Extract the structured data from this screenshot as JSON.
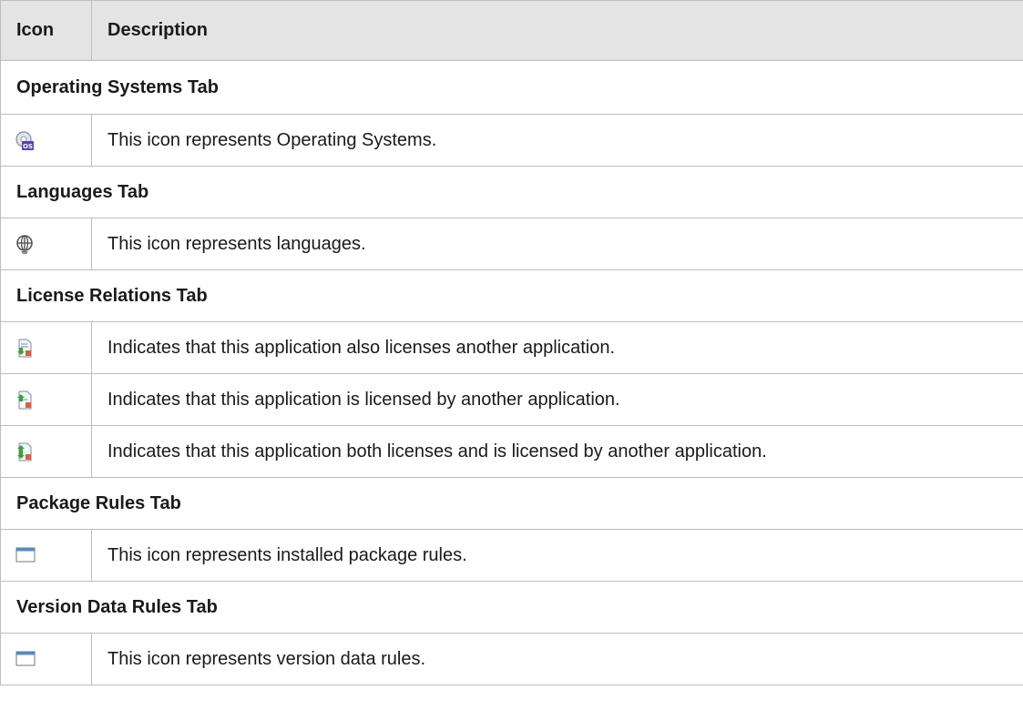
{
  "table": {
    "headers": {
      "icon": "Icon",
      "description": "Description"
    },
    "sections": [
      {
        "title": "Operating Systems Tab",
        "rows": [
          {
            "icon": "operating-system-icon",
            "text": "This icon represents Operating Systems."
          }
        ]
      },
      {
        "title": "Languages Tab",
        "rows": [
          {
            "icon": "globe-icon",
            "text": "This icon represents languages."
          }
        ]
      },
      {
        "title": "License Relations Tab",
        "rows": [
          {
            "icon": "licenses-another-icon",
            "text": "Indicates that this application also licenses another application."
          },
          {
            "icon": "licensed-by-another-icon",
            "text": "Indicates that this application is licensed by another application."
          },
          {
            "icon": "licenses-and-licensed-icon",
            "text": "Indicates that this application both licenses and is licensed by another application."
          }
        ]
      },
      {
        "title": "Package Rules Tab",
        "rows": [
          {
            "icon": "window-icon",
            "text": "This icon represents installed package rules."
          }
        ]
      },
      {
        "title": "Version Data Rules Tab",
        "rows": [
          {
            "icon": "window-icon",
            "text": "This icon represents version data rules."
          }
        ]
      }
    ]
  },
  "colors": {
    "header_bg": "#e4e4e4",
    "border": "#bdbdbd",
    "os_badge": "#5b3fb5",
    "green_arrow": "#3aa23a",
    "window_bar": "#4a8fd6"
  }
}
